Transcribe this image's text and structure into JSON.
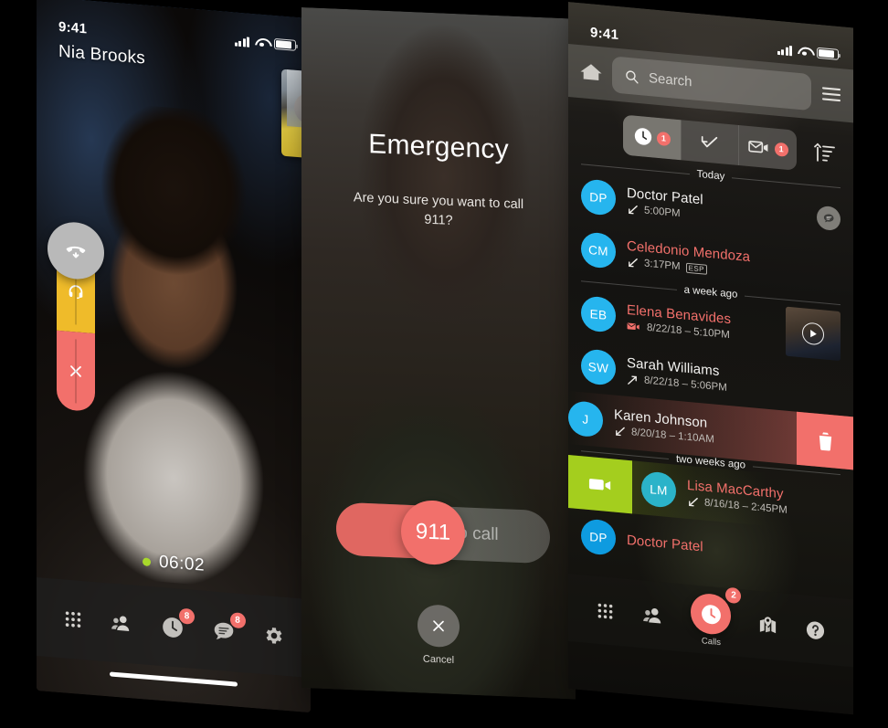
{
  "call_screen": {
    "status_bar": {
      "time": "9:41",
      "signal": "signal-icon",
      "wifi": "wifi-icon",
      "battery": "battery-icon"
    },
    "caller_name": "Nia Brooks",
    "timer": "06:02",
    "controls": {
      "hold_label": "hold-headset",
      "end_label": "end-call",
      "drawer_label": "phone-down"
    },
    "tabs": [
      {
        "name": "dialpad",
        "badge": ""
      },
      {
        "name": "contacts",
        "badge": ""
      },
      {
        "name": "recents",
        "badge": "8"
      },
      {
        "name": "messages",
        "badge": "8"
      },
      {
        "name": "settings",
        "badge": ""
      }
    ]
  },
  "emergency_screen": {
    "title": "Emergency",
    "question": "Are you sure you want to call 911?",
    "slider": {
      "knob_label": "911",
      "hint": "to call"
    },
    "cancel_label": "Cancel"
  },
  "recents_screen": {
    "status_bar": {
      "time": "9:41"
    },
    "home_icon": "home-icon",
    "menu_icon": "hamburger-icon",
    "search": {
      "placeholder": "Search"
    },
    "segments": [
      {
        "name": "recents-clock",
        "badge": "1",
        "active": true
      },
      {
        "name": "checkmark",
        "badge": "",
        "active": false
      },
      {
        "name": "video-voicemail",
        "badge": "1",
        "active": false
      }
    ],
    "sort_icon": "sort-icon",
    "sections": [
      {
        "label": "Today",
        "rows": [
          {
            "initials": "DP",
            "name": "Doctor Patel",
            "time": "5:00PM",
            "direction": "incoming",
            "missed": false,
            "avatar_color": "#26B5EE",
            "action": "chat"
          },
          {
            "initials": "CM",
            "name": "Celedonio Mendoza",
            "time": "3:17PM",
            "direction": "incoming-missed",
            "missed": true,
            "avatar_color": "#26B5EE",
            "tag": "ESP"
          }
        ]
      },
      {
        "label": "a week ago",
        "rows": [
          {
            "initials": "EB",
            "name": "Elena Benavides",
            "time": "8/22/18 – 5:10PM",
            "direction": "videomail",
            "missed": true,
            "avatar_color": "#26B5EE",
            "action": "video-thumb"
          },
          {
            "initials": "SW",
            "name": "Sarah Williams",
            "time": "8/22/18 – 5:06PM",
            "direction": "outgoing",
            "missed": false,
            "avatar_color": "#26B5EE"
          },
          {
            "initials": "J",
            "name": "Karen Johnson",
            "time": "8/20/18 – 1:10AM",
            "direction": "incoming",
            "missed": false,
            "avatar_color": "#26B5EE",
            "swipe": "delete"
          }
        ]
      },
      {
        "label": "two weeks ago",
        "rows": [
          {
            "initials": "LM",
            "name": "Lisa MacCarthy",
            "time": "8/16/18 – 2:45PM",
            "direction": "incoming",
            "missed": true,
            "avatar_color": "#2BB3C9",
            "swipe": "video"
          },
          {
            "initials": "DP",
            "name": "Doctor Patel",
            "time": "",
            "direction": "",
            "missed": true,
            "avatar_color": "#0E9BE0"
          }
        ]
      }
    ],
    "tabs": [
      {
        "name": "dialpad",
        "label": "",
        "badge": "",
        "active": false
      },
      {
        "name": "contacts",
        "label": "",
        "badge": "",
        "active": false
      },
      {
        "name": "calls",
        "label": "Calls",
        "badge": "2",
        "active": true
      },
      {
        "name": "locations",
        "label": "",
        "badge": "",
        "active": false
      },
      {
        "name": "help",
        "label": "",
        "badge": "",
        "active": false
      }
    ]
  },
  "colors": {
    "accent_red": "#F2706B",
    "accent_yellow": "#EFBB2A",
    "accent_green": "#A4CE1E",
    "avatar_blue": "#26B5EE",
    "live_dot": "#A8D82B"
  }
}
